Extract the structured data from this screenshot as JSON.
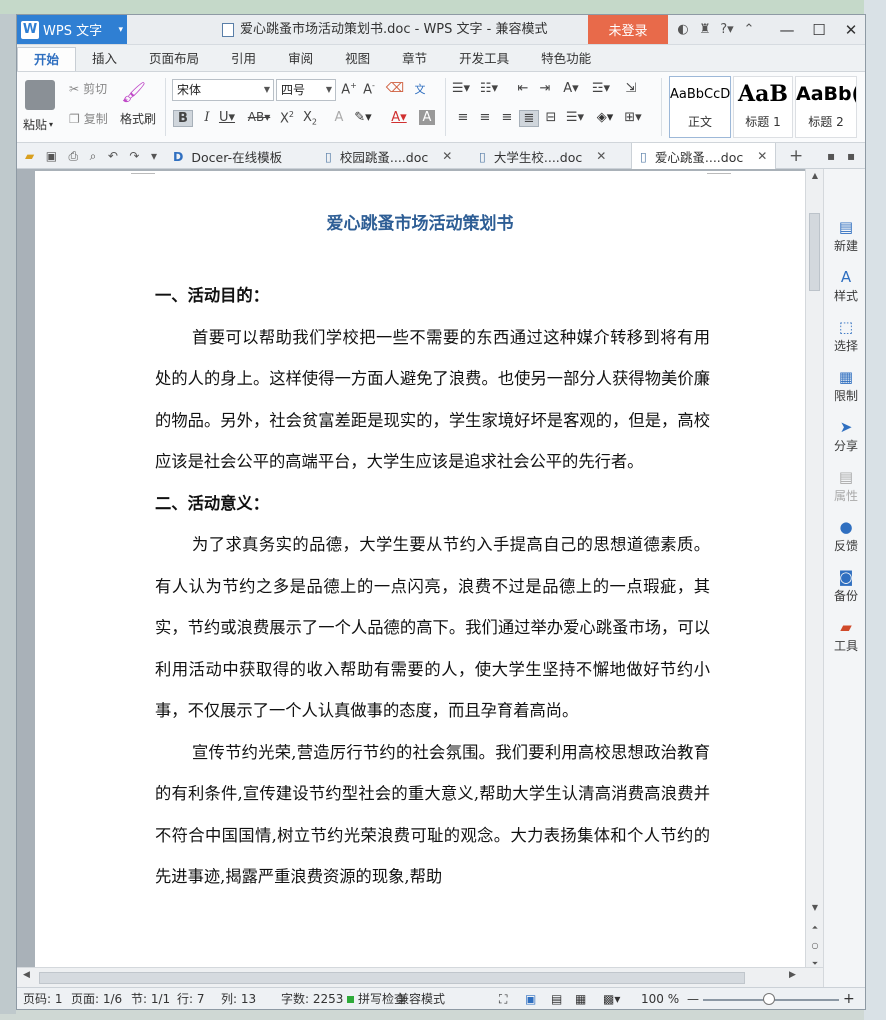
{
  "window": {
    "app_button": "WPS 文字",
    "title": "爱心跳蚤市场活动策划书.doc - WPS 文字 - 兼容模式",
    "login": "未登录"
  },
  "tabs": [
    "开始",
    "插入",
    "页面布局",
    "引用",
    "审阅",
    "视图",
    "章节",
    "开发工具",
    "特色功能"
  ],
  "ribbon": {
    "paste": "粘贴",
    "cut": "剪切",
    "copy": "复制",
    "format_painter": "格式刷",
    "font_name": "宋体",
    "font_size": "四号",
    "styles": [
      {
        "preview": "AaBbCcD",
        "name": "正文"
      },
      {
        "preview": "AaB",
        "name": "标题 1"
      },
      {
        "preview": "AaBb(",
        "name": "标题 2"
      }
    ]
  },
  "doc_tabs": [
    "Docer-在线模板",
    "校园跳蚤....doc",
    "大学生校....doc",
    "爱心跳蚤....doc"
  ],
  "document": {
    "title": "爱心跳蚤市场活动策划书",
    "h1": "一、活动目的：",
    "p1": "首要可以帮助我们学校把一些不需要的东西通过这种媒介转移到将有用处的人的身上。这样使得一方面人避免了浪费。也使另一部分人获得物美价廉的物品。另外，社会贫富差距是现实的，学生家境好坏是客观的，但是，高校应该是社会公平的高端平台，大学生应该是追求社会公平的先行者。",
    "h2": "二、活动意义：",
    "p2": "为了求真务实的品德，大学生要从节约入手提高自己的思想道德素质。有人认为节约之多是品德上的一点闪亮，浪费不过是品德上的一点瑕疵，其实，节约或浪费展示了一个人品德的高下。我们通过举办爱心跳蚤市场，可以利用活动中获取得的收入帮助有需要的人，使大学生坚持不懈地做好节约小事，不仅展示了一个人认真做事的态度，而且孕育着高尚。",
    "p3": "宣传节约光荣,营造厉行节约的社会氛围。我们要利用高校思想政治教育的有利条件,宣传建设节约型社会的重大意义,帮助大学生认清高消费高浪费并不符合中国国情,树立节约光荣浪费可耻的观念。大力表扬集体和个人节约的先进事迹,揭露严重浪费资源的现象,帮助"
  },
  "side_panel": [
    "新建",
    "样式",
    "选择",
    "限制",
    "分享",
    "属性",
    "反馈",
    "备份",
    "工具"
  ],
  "status": {
    "page_code": "页码: 1",
    "pages": "页面: 1/6",
    "section": "节: 1/1",
    "row": "行: 7",
    "col": "列: 13",
    "words": "字数: 2253",
    "spell": "拼写检查",
    "compat": "兼容模式",
    "zoom": "100 %"
  }
}
